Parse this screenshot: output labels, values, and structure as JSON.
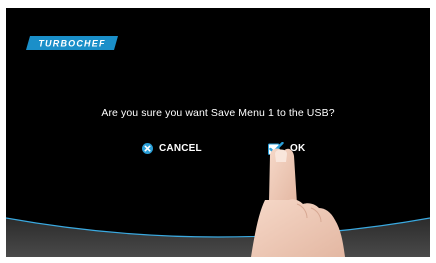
{
  "brand": {
    "logo_text": "TURBOCHEF",
    "logo_color": "#1a8fc9"
  },
  "dialog": {
    "question": "Are you sure you want Save Menu 1 to the USB?",
    "cancel_label": "CANCEL",
    "ok_label": "OK",
    "cancel_icon": "close-circle-icon",
    "ok_icon": "checkbox-checked-icon"
  },
  "colors": {
    "screen_background": "#000000",
    "accent_blue": "#2a9fd8",
    "footer_band": "#3a3a3a",
    "text": "#ffffff"
  }
}
